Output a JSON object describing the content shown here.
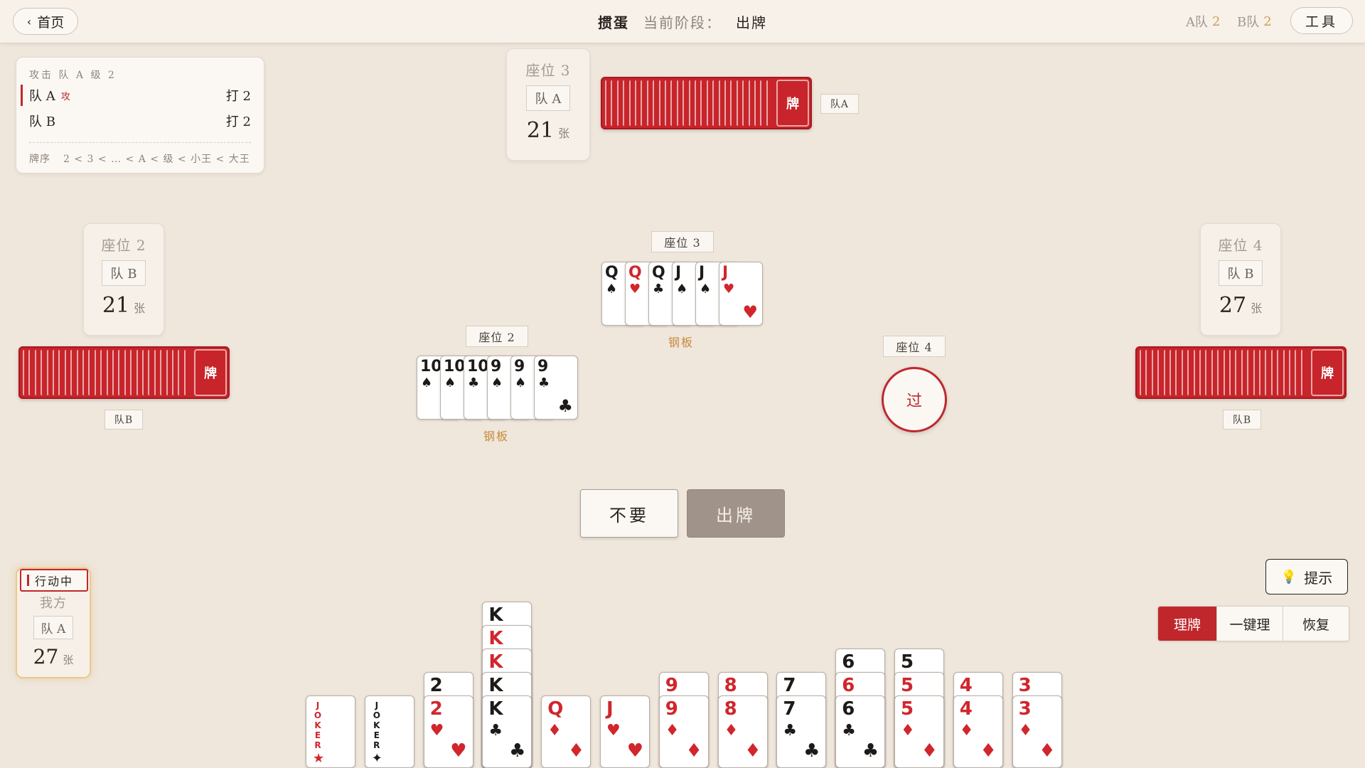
{
  "header": {
    "home": "首页",
    "game": "掼蛋",
    "phase_label": "当前阶段：",
    "phase_value": "出牌",
    "team_a_label": "A队",
    "team_a_level": "2",
    "team_b_label": "B队",
    "team_b_level": "2",
    "tools": "工具"
  },
  "info": {
    "header": "攻击 队 A 级 2",
    "teams": [
      {
        "name": "队 A",
        "badge": "攻",
        "level": "打 2"
      },
      {
        "name": "队 B",
        "badge": "",
        "level": "打 2"
      }
    ],
    "order_label": "牌序",
    "order_text": "2 < 3 < … < A < 级 < 小王 < 大王"
  },
  "seats": {
    "top": {
      "name": "座位 3",
      "team": "队 A",
      "count": "21",
      "unit": "张",
      "tag": "队A"
    },
    "left": {
      "name": "座位 2",
      "team": "队 B",
      "count": "21",
      "unit": "张",
      "tag": "队B"
    },
    "right": {
      "name": "座位 4",
      "team": "队 B",
      "count": "27",
      "unit": "张",
      "tag": "队B"
    }
  },
  "back_label": "牌",
  "played": {
    "seat3": {
      "label": "座位 3",
      "combo": "钢板",
      "cards": [
        {
          "rank": "Q",
          "suit": "♠",
          "color": "black"
        },
        {
          "rank": "Q",
          "suit": "♥",
          "color": "red"
        },
        {
          "rank": "Q",
          "suit": "♣",
          "color": "black"
        },
        {
          "rank": "J",
          "suit": "♠",
          "color": "black"
        },
        {
          "rank": "J",
          "suit": "♠",
          "color": "black"
        },
        {
          "rank": "J",
          "suit": "♥",
          "color": "red"
        }
      ]
    },
    "seat2": {
      "label": "座位 2",
      "combo": "钢板",
      "cards": [
        {
          "rank": "10",
          "suit": "♠",
          "color": "black"
        },
        {
          "rank": "10",
          "suit": "♠",
          "color": "black"
        },
        {
          "rank": "10",
          "suit": "♣",
          "color": "black"
        },
        {
          "rank": "9",
          "suit": "♠",
          "color": "black"
        },
        {
          "rank": "9",
          "suit": "♠",
          "color": "black"
        },
        {
          "rank": "9",
          "suit": "♣",
          "color": "black"
        }
      ]
    },
    "seat4": {
      "label": "座位 4",
      "action": "过"
    }
  },
  "actions": {
    "pass": "不要",
    "play": "出牌"
  },
  "me": {
    "status": "行动中",
    "name": "我方",
    "team": "队 A",
    "count": "27",
    "unit": "张"
  },
  "controls": {
    "hint": "提示",
    "hint_icon": "lightbulb-icon",
    "sort": "理牌",
    "auto_sort": "一键理",
    "restore": "恢复"
  },
  "hand": [
    {
      "cards": [
        {
          "rank": "JOKER",
          "suit": "★",
          "color": "red",
          "joker": true
        }
      ]
    },
    {
      "cards": [
        {
          "rank": "JOKER",
          "suit": "✦",
          "color": "black",
          "joker": true
        }
      ]
    },
    {
      "cards": [
        {
          "rank": "2",
          "suit": "",
          "color": "black"
        },
        {
          "rank": "2",
          "suit": "♥",
          "color": "red"
        }
      ]
    },
    {
      "cards": [
        {
          "rank": "K",
          "suit": "",
          "color": "black"
        },
        {
          "rank": "K",
          "suit": "",
          "color": "red"
        },
        {
          "rank": "K",
          "suit": "",
          "color": "red"
        },
        {
          "rank": "K",
          "suit": "",
          "color": "black"
        },
        {
          "rank": "K",
          "suit": "♣",
          "color": "black"
        }
      ]
    },
    {
      "cards": [
        {
          "rank": "Q",
          "suit": "♦",
          "color": "red"
        }
      ]
    },
    {
      "cards": [
        {
          "rank": "J",
          "suit": "♥",
          "color": "red"
        }
      ]
    },
    {
      "cards": [
        {
          "rank": "9",
          "suit": "",
          "color": "red"
        },
        {
          "rank": "9",
          "suit": "♦",
          "color": "red"
        }
      ]
    },
    {
      "cards": [
        {
          "rank": "8",
          "suit": "",
          "color": "red"
        },
        {
          "rank": "8",
          "suit": "♦",
          "color": "red"
        }
      ]
    },
    {
      "cards": [
        {
          "rank": "7",
          "suit": "",
          "color": "black"
        },
        {
          "rank": "7",
          "suit": "♣",
          "color": "black"
        }
      ]
    },
    {
      "cards": [
        {
          "rank": "6",
          "suit": "",
          "color": "black"
        },
        {
          "rank": "6",
          "suit": "",
          "color": "red"
        },
        {
          "rank": "6",
          "suit": "♣",
          "color": "black"
        }
      ]
    },
    {
      "cards": [
        {
          "rank": "5",
          "suit": "",
          "color": "black"
        },
        {
          "rank": "5",
          "suit": "",
          "color": "red"
        },
        {
          "rank": "5",
          "suit": "♦",
          "color": "red"
        }
      ]
    },
    {
      "cards": [
        {
          "rank": "4",
          "suit": "",
          "color": "red"
        },
        {
          "rank": "4",
          "suit": "♦",
          "color": "red"
        }
      ]
    },
    {
      "cards": [
        {
          "rank": "3",
          "suit": "",
          "color": "red"
        },
        {
          "rank": "3",
          "suit": "♦",
          "color": "red"
        }
      ]
    }
  ],
  "colors": {
    "accent": "#c0272d",
    "background": "#efe6dc",
    "card_back": "#c8242b",
    "combo": "#c78a3a"
  }
}
